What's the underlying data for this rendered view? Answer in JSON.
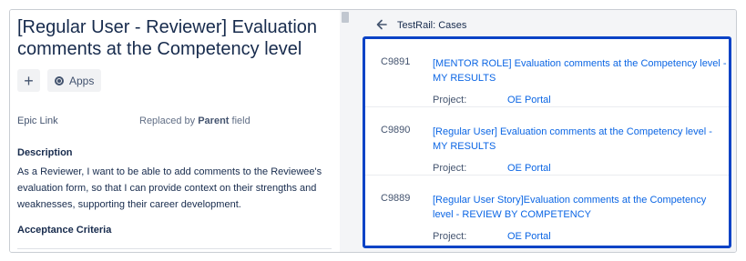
{
  "issue": {
    "title": "[Regular User - Reviewer] Evaluation comments at the Competency level",
    "add_button": "+",
    "apps_button": "Apps",
    "epic_link_label": "Epic Link",
    "epic_link_value_prefix": "Replaced by",
    "epic_link_value_bold": "Parent",
    "epic_link_value_suffix": "field",
    "description_heading": "Description",
    "description_text": "As a Reviewer, I want to be able to add comments to the Reviewee's evaluation form, so that I can provide context on their strengths and weaknesses, supporting their career development.",
    "acceptance_heading": "Acceptance Criteria"
  },
  "testrail": {
    "header_title": "TestRail: Cases",
    "project_label": "Project:",
    "cases": [
      {
        "id": "C9891",
        "title": "[MENTOR ROLE] Evaluation comments at the Competency level - MY RESULTS",
        "project": "OE Portal"
      },
      {
        "id": "C9890",
        "title": "[Regular User] Evaluation comments at the Competency level - MY RESULTS",
        "project": "OE Portal"
      },
      {
        "id": "C9889",
        "title": "[Regular User Story]Evaluation comments at the Competency level - REVIEW BY COMPETENCY",
        "project": "OE Portal"
      }
    ]
  },
  "colors": {
    "link": "#0c66e4",
    "highlight_border": "#0b43c6",
    "panel_bg": "#f4f5f7"
  }
}
